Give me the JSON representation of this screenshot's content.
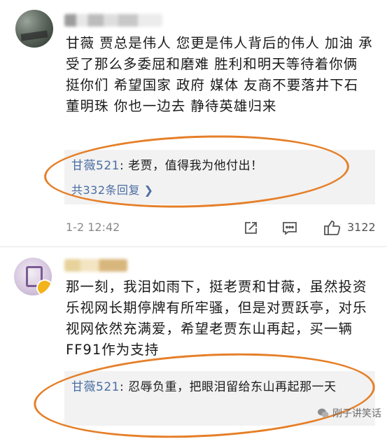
{
  "comments": [
    {
      "text": "甘薇 贾总是伟人 您更是伟人背后的伟人 加油 承受了那么多委屈和磨难 胜利和明天等待着你俩 挺你们 希望国家 政府 媒体 友商不要落井下石  董明珠 你也一边去 静待英雄归来",
      "reply": {
        "name": "甘薇521",
        "text": ": 老贾，值得我为他付出！",
        "count_label": "共332条回复",
        "chevron": "❯"
      },
      "time": "1-2 12:42",
      "likes": "3122"
    },
    {
      "text": "那一刻，我泪如雨下，挺老贾和甘薇，虽然投资乐视网长期停牌有所牢骚，但是对贾跃亭，对乐视网依然充满爱，希望老贾东山再起，买一辆FF91作为支持",
      "reply": {
        "name": "甘薇521",
        "text": ": 忍辱负重，把眼泪留给东山再起那一天"
      }
    }
  ],
  "watermark": "刚子讲笑话",
  "colors": {
    "highlight": "#e57f28",
    "link": "#4a6ea3",
    "reply_bg": "#f2f2f2"
  }
}
